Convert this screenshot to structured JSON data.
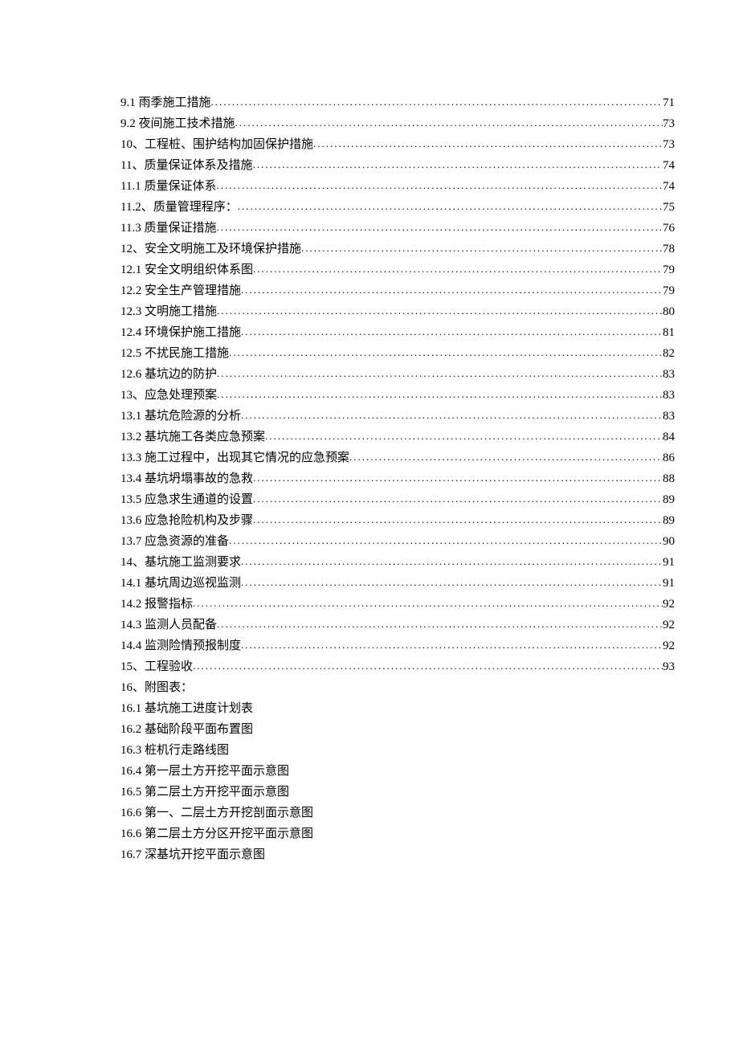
{
  "toc_entries": [
    {
      "label": "9.1 雨季施工措施",
      "page": "71"
    },
    {
      "label": "9.2 夜间施工技术措施",
      "page": "73"
    },
    {
      "label": "10、工程桩、围护结构加固保护措施",
      "page": "73"
    },
    {
      "label": "11、质量保证体系及措施",
      "page": "74"
    },
    {
      "label": "11.1 质量保证体系",
      "page": "74"
    },
    {
      "label": "11.2、质量管理程序：",
      "page": "75"
    },
    {
      "label": "11.3 质量保证措施",
      "page": "76"
    },
    {
      "label": "12、安全文明施工及环境保护措施",
      "page": "78"
    },
    {
      "label": "12.1 安全文明组织体系图",
      "page": "79"
    },
    {
      "label": "12.2 安全生产管理措施",
      "page": "79"
    },
    {
      "label": "12.3 文明施工措施",
      "page": "80"
    },
    {
      "label": "12.4  环境保护施工措施",
      "page": "81"
    },
    {
      "label": "12.5 不扰民施工措施",
      "page": "82"
    },
    {
      "label": "12.6  基坑边的防护",
      "page": "83"
    },
    {
      "label": "13、应急处理预案",
      "page": "83"
    },
    {
      "label": "13.1  基坑危险源的分析",
      "page": "83"
    },
    {
      "label": "13.2  基坑施工各类应急预案",
      "page": "84"
    },
    {
      "label": "13.3  施工过程中，出现其它情况的应急预案",
      "page": "86"
    },
    {
      "label": "13.4  基坑坍塌事故的急救",
      "page": "88"
    },
    {
      "label": "13.5  应急求生通道的设置",
      "page": "89"
    },
    {
      "label": "13.6  应急抢险机构及步骤",
      "page": "89"
    },
    {
      "label": "13.7 应急资源的准备",
      "page": "90"
    },
    {
      "label": "14、基坑施工监测要求",
      "page": "91"
    },
    {
      "label": "14.1 基坑周边巡视监测",
      "page": "91"
    },
    {
      "label": "14.2 报警指标",
      "page": "92"
    },
    {
      "label": "14.3 监测人员配备",
      "page": "92"
    },
    {
      "label": "14.4 监测险情预报制度",
      "page": "92"
    },
    {
      "label": "15、工程验收",
      "page": "93"
    }
  ],
  "plain_entries": [
    "16、附图表：",
    "16.1 基坑施工进度计划表",
    "16.2 基础阶段平面布置图",
    "16.3 桩机行走路线图",
    "16.4 第一层土方开挖平面示意图",
    "16.5 第二层土方开挖平面示意图",
    "16.6 第一、二层土方开挖剖面示意图",
    "16.6 第二层土方分区开挖平面示意图",
    "16.7 深基坑开挖平面示意图"
  ]
}
